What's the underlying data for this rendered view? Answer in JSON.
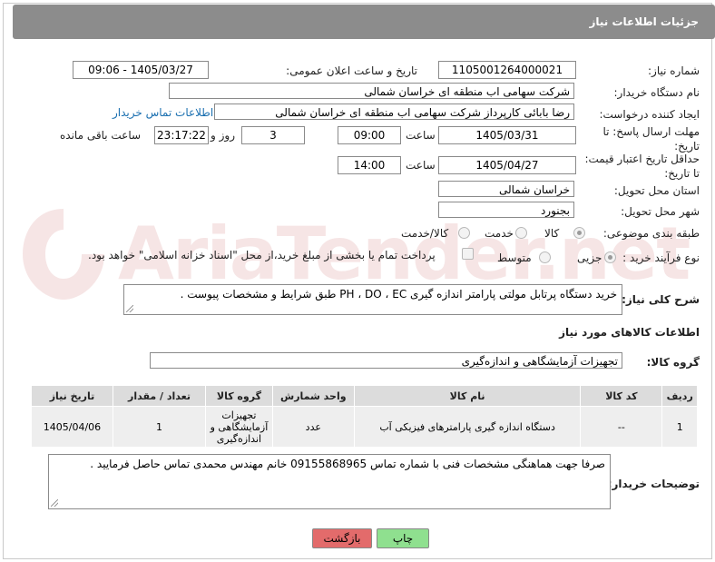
{
  "header": {
    "title": "جزئیات اطلاعات نیاز"
  },
  "form": {
    "need_number": {
      "label": "شماره نیاز:",
      "value": "1105001264000021"
    },
    "announce": {
      "label": "تاریخ و ساعت اعلان عمومی:",
      "value": "1405/03/27 - 09:06"
    },
    "buyer_org": {
      "label": "نام دستگاه خریدار:",
      "value": "شرکت سهامی اب منطقه ای خراسان شمالی"
    },
    "requester": {
      "label": "ایجاد کننده درخواست:",
      "value": "رضا بابائی کارپرداز شرکت سهامی اب منطقه ای خراسان شمالی",
      "contact_link": "اطلاعات تماس خریدار"
    },
    "reply_deadline": {
      "label": "مهلت ارسال پاسخ: تا تاریخ:",
      "date": "1405/03/31",
      "time_label": "ساعت",
      "time": "09:00",
      "days": "3",
      "days_label": "روز و",
      "remaining": "23:17:22",
      "remaining_label": "ساعت باقی مانده"
    },
    "price_validity": {
      "label": "حداقل تاریخ اعتبار قیمت: تا تاریخ:",
      "date": "1405/04/27",
      "time_label": "ساعت",
      "time": "14:00"
    },
    "delivery_province": {
      "label": "استان محل تحویل:",
      "value": "خراسان شمالی"
    },
    "delivery_city": {
      "label": "شهر محل تحویل:",
      "value": "بجنورد"
    },
    "category": {
      "label": "طبقه بندی موضوعی:",
      "options": [
        "کالا",
        "خدمت",
        "کالا/خدمت"
      ],
      "selected": "کالا"
    },
    "process": {
      "label": "نوع فرآیند خرید :",
      "options": [
        "جزیی",
        "متوسط"
      ],
      "selected": "جزیی",
      "note": "پرداخت تمام یا بخشی از مبلغ خرید،از محل \"اسناد خزانه اسلامی\" خواهد بود."
    },
    "description": {
      "label": "شرح کلی نیاز:",
      "value": "خرید دستگاه پرتابل مولتی پارامتر اندازه گیری PH ، DO ، EC طبق شرایط و مشخصات پیوست ."
    }
  },
  "goods": {
    "section_title": "اطلاعات کالاهای مورد نیاز",
    "group_label": "گروه کالا:",
    "group_value": "تجهیزات آزمایشگاهی و اندازه‌گیری",
    "columns": [
      "ردیف",
      "کد کالا",
      "نام کالا",
      "واحد شمارش",
      "گروه کالا",
      "تعداد / مقدار",
      "تاریخ نیاز"
    ],
    "rows": [
      {
        "row": "1",
        "code": "--",
        "name": "دستگاه اندازه گیری پارامترهای فیزیکی آب",
        "unit": "عدد",
        "group": "تجهیزات آزمایشگاهی و اندازه‌گیری",
        "qty": "1",
        "date": "1405/04/06"
      }
    ]
  },
  "buyer_notes": {
    "label": "توضیحات خریدار:",
    "value": "صرفا جهت هماهنگی مشخصات فنی با شماره تماس 09155868965 خانم مهندس محمدی تماس حاصل فرمایید ."
  },
  "buttons": {
    "print": "چاپ",
    "back": "بازگشت"
  },
  "colors": {
    "header_bg": "#8c8c8c",
    "print_btn": "#8fe08f",
    "back_btn": "#e36b6b",
    "link": "#1a6fb0"
  }
}
